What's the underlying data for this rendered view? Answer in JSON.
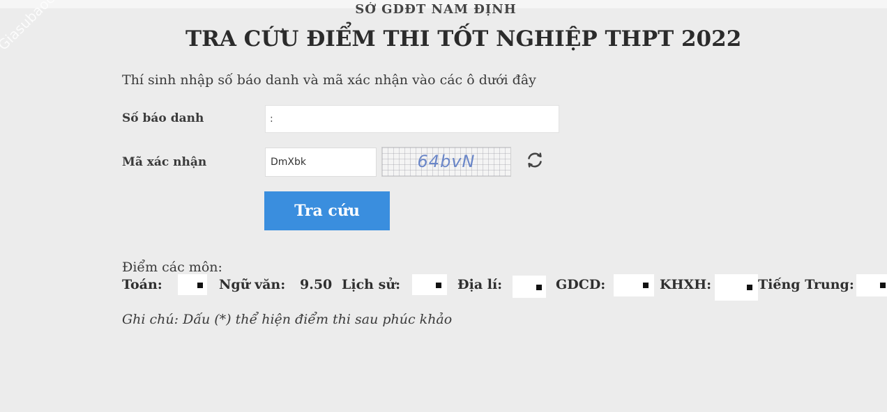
{
  "watermark": "Giasubaochau.net",
  "header": {
    "org": "SỞ GDĐT NAM ĐỊNH",
    "title": "TRA CỨU ĐIỂM THI TỐT NGHIỆP THPT 2022"
  },
  "form": {
    "instruction": "Thí sinh nhập số báo danh và mã xác nhận vào các ô dưới đây",
    "sbd_label": "Số báo danh",
    "sbd_value": ":",
    "mxn_label": "Mã xác nhận",
    "mxn_value": "DmXbk",
    "captcha_text": "64bvN",
    "submit_label": "Tra cứu",
    "refresh_icon": "refresh-icon",
    "button_color": "#3a8ede",
    "captcha_color": "#6a86c8"
  },
  "results": {
    "heading": "Điểm các môn:",
    "subjects": [
      {
        "label": "Toán:",
        "value": ""
      },
      {
        "label": "Ngữ văn:",
        "value": "9.50"
      },
      {
        "label": "Lịch sử:",
        "value": ""
      },
      {
        "label": "Địa lí:",
        "value": ""
      },
      {
        "label": "GDCD:",
        "value": ""
      },
      {
        "label": "KHXH:",
        "value": ""
      },
      {
        "label": "Tiếng Trung:",
        "value": ""
      }
    ],
    "note": "Ghi chú: Dấu (*) thể hiện điểm thi sau phúc khảo"
  }
}
